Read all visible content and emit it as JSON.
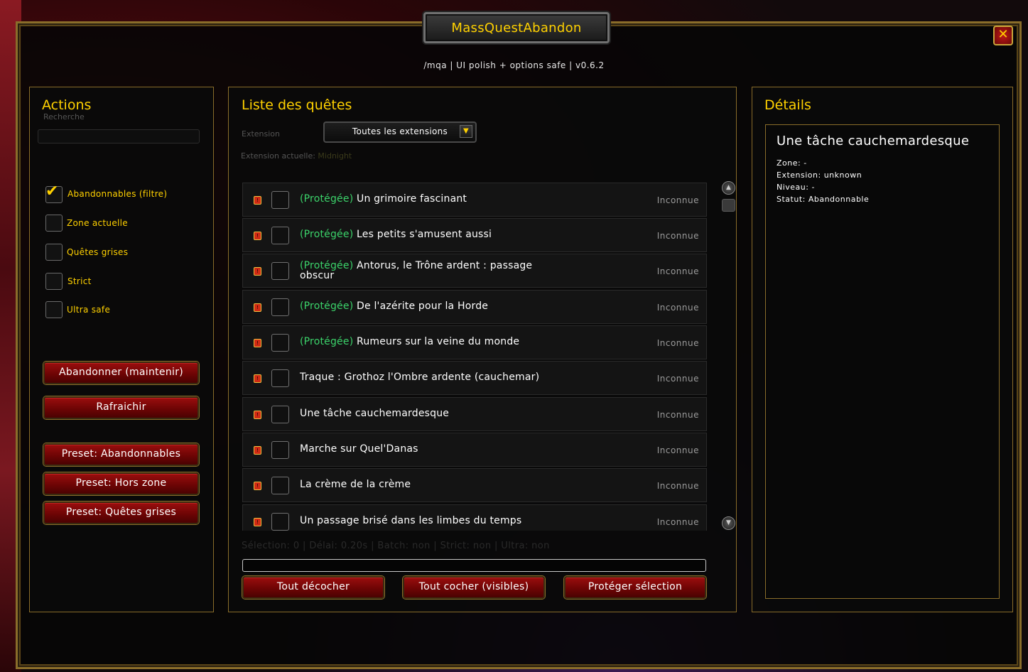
{
  "window": {
    "title": "MassQuestAbandon",
    "subtitle": "/mqa | UI polish + options safe | v0.6.2",
    "close_label": "✕"
  },
  "actions": {
    "title": "Actions",
    "search_label": "Recherche",
    "search_value": "",
    "checkboxes": [
      {
        "label": "Abandonnables (filtre)",
        "checked": true
      },
      {
        "label": "Zone actuelle",
        "checked": false
      },
      {
        "label": "Quêtes grises",
        "checked": false
      },
      {
        "label": "Strict",
        "checked": false
      },
      {
        "label": "Ultra safe",
        "checked": false
      }
    ],
    "buttons": {
      "abandon": "Abandonner (maintenir)",
      "refresh": "Rafraichir",
      "preset_abandonables": "Preset: Abandonnables",
      "preset_outzone": "Preset: Hors zone",
      "preset_grey": "Preset: Quêtes grises"
    }
  },
  "quests": {
    "title": "Liste des quêtes",
    "extension_label": "Extension",
    "extension_value": "Toutes les extensions",
    "current_extension_prefix": "Extension actuelle: ",
    "current_extension_value": "Midnight",
    "protected_tag": "(Protégée)",
    "rows": [
      {
        "protected": true,
        "title": "Un grimoire fascinant",
        "status": "Inconnue"
      },
      {
        "protected": true,
        "title": "Les petits s'amusent aussi",
        "status": "Inconnue"
      },
      {
        "protected": true,
        "title": "Antorus, le Trône ardent : passage obscur",
        "status": "Inconnue"
      },
      {
        "protected": true,
        "title": "De l'azérite pour la Horde",
        "status": "Inconnue"
      },
      {
        "protected": true,
        "title": "Rumeurs sur la veine du monde",
        "status": "Inconnue"
      },
      {
        "protected": false,
        "title": "Traque : Grothoz l'Ombre ardente (cauchemar)",
        "status": "Inconnue"
      },
      {
        "protected": false,
        "title": "Une tâche cauchemardesque",
        "status": "Inconnue"
      },
      {
        "protected": false,
        "title": "Marche sur Quel'Danas",
        "status": "Inconnue"
      },
      {
        "protected": false,
        "title": "La crème de la crème",
        "status": "Inconnue"
      },
      {
        "protected": false,
        "title": "Un passage brisé dans les limbes du temps",
        "status": "Inconnue"
      }
    ],
    "status_line": "Sélection: 0 | Délai: 0.20s | Batch: non | Strict: non | Ultra: non",
    "progress": 0,
    "buttons": {
      "uncheck_all": "Tout décocher",
      "check_visible": "Tout cocher (visibles)",
      "protect_selection": "Protéger sélection"
    }
  },
  "details": {
    "title": "Détails",
    "quest_title": "Une tâche cauchemardesque",
    "lines": [
      "Zone: -",
      "Extension: unknown",
      "Niveau: -",
      "Statut: Abandonnable"
    ]
  }
}
